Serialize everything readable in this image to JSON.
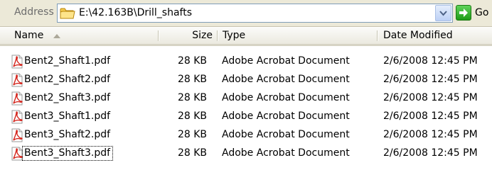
{
  "address": {
    "label": "Address",
    "path": "E:\\42.163B\\Drill_shafts",
    "go_label": "Go"
  },
  "columns": {
    "name": "Name",
    "size": "Size",
    "type": "Type",
    "date": "Date Modified"
  },
  "files": [
    {
      "name": "Bent2_Shaft1.pdf",
      "size": "28 KB",
      "type": "Adobe Acrobat Document",
      "date": "2/6/2008 12:45 PM"
    },
    {
      "name": "Bent2_Shaft2.pdf",
      "size": "28 KB",
      "type": "Adobe Acrobat Document",
      "date": "2/6/2008 12:45 PM"
    },
    {
      "name": "Bent2_Shaft3.pdf",
      "size": "28 KB",
      "type": "Adobe Acrobat Document",
      "date": "2/6/2008 12:45 PM"
    },
    {
      "name": "Bent3_Shaft1.pdf",
      "size": "28 KB",
      "type": "Adobe Acrobat Document",
      "date": "2/6/2008 12:45 PM"
    },
    {
      "name": "Bent3_Shaft2.pdf",
      "size": "28 KB",
      "type": "Adobe Acrobat Document",
      "date": "2/6/2008 12:45 PM"
    },
    {
      "name": "Bent3_Shaft3.pdf",
      "size": "28 KB",
      "type": "Adobe Acrobat Document",
      "date": "2/6/2008 12:45 PM"
    }
  ],
  "icons": {
    "folder": "folder-icon",
    "dropdown": "chevron-down-icon",
    "go": "go-arrow-icon",
    "file": "pdf-file-icon",
    "sort": "sort-ascending-icon"
  },
  "colors": {
    "toolbar_bg": "#ece9d8",
    "go_green": "#1e9b16",
    "pdf_red": "#d4241c",
    "field_border": "#7f9db9"
  }
}
